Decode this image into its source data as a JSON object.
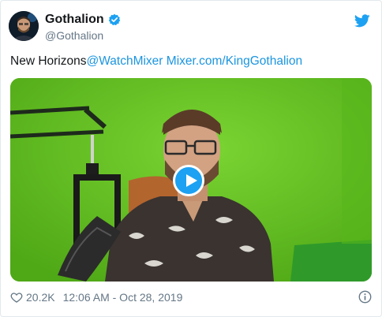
{
  "user": {
    "display_name": "Gothalion",
    "handle": "@Gothalion",
    "verified": true
  },
  "tweet": {
    "text_plain": "New Horizons",
    "mention": "@WatchMixer",
    "url": "Mixer.com/KingGothalion"
  },
  "media": {
    "type": "video",
    "play_icon": "play-icon"
  },
  "footer": {
    "likes": "20.2K",
    "timestamp": "12:06 AM - Oct 28, 2019"
  },
  "colors": {
    "twitter_blue": "#1da1f2",
    "link": "#1b95e0",
    "muted": "#657786",
    "green_screen": "#63c21f"
  },
  "icons": {
    "brand": "twitter-bird-icon",
    "verified": "verified-badge-icon",
    "like": "heart-icon",
    "info": "info-icon"
  }
}
